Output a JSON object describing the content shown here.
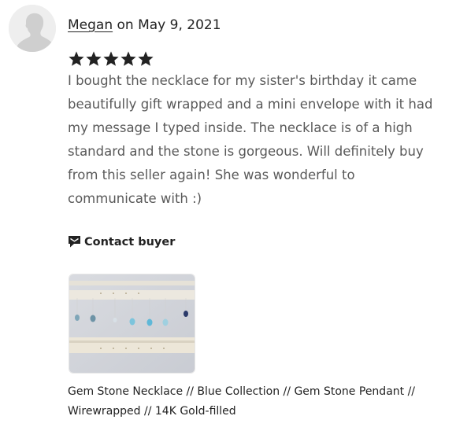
{
  "reviewer": {
    "name": "Megan",
    "date_text": " on May 9, 2021"
  },
  "rating": {
    "stars": 5,
    "max": 5,
    "color": "#222222"
  },
  "review": {
    "text": "I bought the necklace for my sister's birthday it came beautifully gift wrapped and a mini envelope with it had my message I typed inside. The necklace is of a high standard and the stone is gorgeous. Will definitely buy from this seller again! She was wonderful to communicate with :)"
  },
  "contact": {
    "label": "Contact buyer",
    "icon": "chat-bubble-icon"
  },
  "listing": {
    "title": "Gem Stone Necklace // Blue Collection // Gem Stone Pendant // Wirewrapped // 14K Gold-filled"
  },
  "colors": {
    "text_primary": "#222222",
    "text_body": "#595959",
    "avatar_bg": "#eeeeee"
  }
}
